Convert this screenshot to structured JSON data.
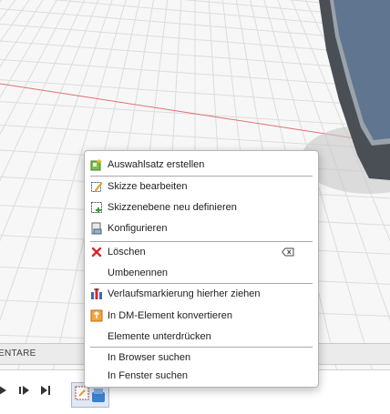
{
  "panels": {
    "comments_label": "ENTARE"
  },
  "timeline": {
    "buttons": [
      "play-icon",
      "step-forward-icon",
      "end-icon"
    ],
    "feature_icon": "sketch-feature-icon"
  },
  "colors": {
    "menu_bg": "#ffffff",
    "separator": "#a8a8a8",
    "delete_red": "#d9262b",
    "axis_red": "#e07070",
    "body_dark": "#4a535f",
    "body_face": "#5f7590"
  },
  "context_menu": {
    "items": [
      {
        "label": "Auswahlsatz erstellen",
        "icon": "selection-set-icon"
      },
      {
        "label": "Skizze bearbeiten",
        "icon": "edit-sketch-icon"
      },
      {
        "label": "Skizzenebene neu definieren",
        "icon": "redefine-plane-icon"
      },
      {
        "label": "Konfigurieren",
        "icon": "configure-icon"
      },
      {
        "label": "Löschen",
        "icon": "delete-icon",
        "shortcut_icon": "backspace-key-icon"
      },
      {
        "label": "Umbenennen",
        "icon": ""
      },
      {
        "label": "Verlaufsmarkierung hierher ziehen",
        "icon": "history-marker-icon"
      },
      {
        "label": "In DM-Element konvertieren",
        "icon": "convert-dm-icon"
      },
      {
        "label": "Elemente unterdrücken",
        "icon": ""
      },
      {
        "label": "In Browser suchen",
        "icon": ""
      },
      {
        "label": "In Fenster suchen",
        "icon": ""
      }
    ]
  }
}
